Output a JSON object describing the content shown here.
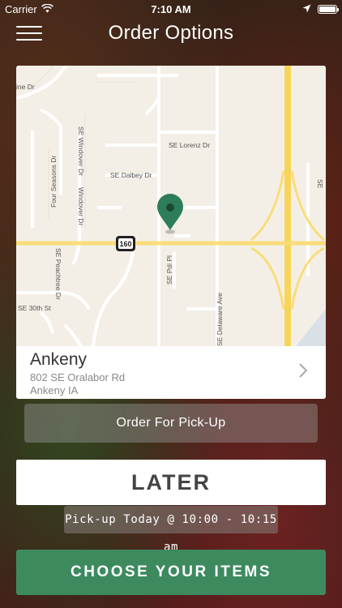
{
  "status": {
    "carrier": "Carrier",
    "time": "7:10 AM"
  },
  "header": {
    "title": "Order Options"
  },
  "map": {
    "street_labels": {
      "top_left_partial": "ine Dr",
      "windover_dr_top": "SE Windover Dr",
      "windover_dr_bottom": "Windover Dr",
      "four_seasons": "Four Seasons Dr",
      "lorenz": "SE Lorenz Dr",
      "dalbey": "SE Dalbey Dr",
      "peachtree": "SE Peachtree Dr",
      "pdi": "SE Pdi Pl",
      "delaware": "SE Delaware Ave",
      "thirtieth": "SE 30th St",
      "right_edge": "SE"
    },
    "route_shield": "160",
    "pin_color": "#2e7d5a",
    "highway_color": "#f6d55a"
  },
  "location": {
    "name": "Ankeny",
    "address": "802 SE Oralabor Rd",
    "city": "Ankeny IA"
  },
  "order_type": {
    "label": "Order For Pick-Up"
  },
  "timing": {
    "label": "LATER"
  },
  "pickup_time": {
    "label": "Pick-up Today @ 10:00 - 10:15 am"
  },
  "cta": {
    "label": "CHOOSE YOUR ITEMS",
    "color": "#3d8a5f"
  }
}
